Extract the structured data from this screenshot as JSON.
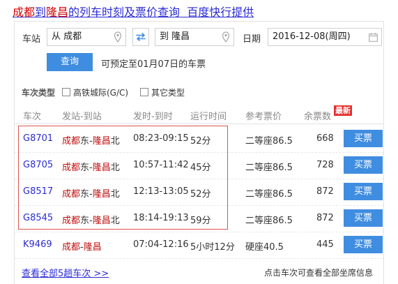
{
  "header": {
    "title_from": "成都",
    "title_to_word": "到",
    "title_to": "隆昌",
    "title_rest": "的列车时刻及票价查询",
    "title_provider": "百度快行提供"
  },
  "search": {
    "station_label": "车站",
    "from_value": "从 成都",
    "to_value": "到 隆昌",
    "date_label": "日期",
    "date_value": "2016-12-08(周四)",
    "query_label": "查询",
    "presale_text": "可预定至01月07日的车票"
  },
  "filter": {
    "label": "车次类型",
    "opt1": "高铁城际(G/C)",
    "opt2": "其它类型"
  },
  "columns": {
    "no": "车次",
    "stations": "发站-到站",
    "times": "发时-到时",
    "duration": "运行时间",
    "price": "参考票价",
    "left": "余票数",
    "new_badge": "最新"
  },
  "rows": [
    {
      "no": "G8701",
      "from": "成都",
      "from_suffix": "东-",
      "to": "隆昌",
      "to_suffix": "北",
      "times": "08:23-09:15",
      "duration": "52分",
      "price": "二等座86.5",
      "left": "668",
      "buy": "买票"
    },
    {
      "no": "G8705",
      "from": "成都",
      "from_suffix": "东-",
      "to": "隆昌",
      "to_suffix": "北",
      "times": "10:57-11:42",
      "duration": "45分",
      "price": "二等座86.5",
      "left": "728",
      "buy": "买票"
    },
    {
      "no": "G8517",
      "from": "成都",
      "from_suffix": "东-",
      "to": "隆昌",
      "to_suffix": "北",
      "times": "12:13-13:05",
      "duration": "52分",
      "price": "二等座86.5",
      "left": "872",
      "buy": "买票"
    },
    {
      "no": "G8545",
      "from": "成都",
      "from_suffix": "东-",
      "to": "隆昌",
      "to_suffix": "北",
      "times": "18:14-19:13",
      "duration": "59分",
      "price": "二等座86.5",
      "left": "872",
      "buy": "买票"
    },
    {
      "no": "K9469",
      "from": "成都",
      "from_suffix": "-",
      "to": "隆昌",
      "to_suffix": "",
      "times": "07:04-12:16",
      "duration": "5小时12分",
      "price": "硬座40.5",
      "left": "445",
      "buy": "买票"
    }
  ],
  "footer": {
    "all_link": "查看全部5趟车次 >>",
    "tip": "点击车次可查看全部坐席信息"
  },
  "colors": {
    "accent": "#3f8de0",
    "link": "#2b2bd6",
    "station_red": "#c01010",
    "highlight_border": "#d9534f",
    "badge": "#e52e2e"
  }
}
